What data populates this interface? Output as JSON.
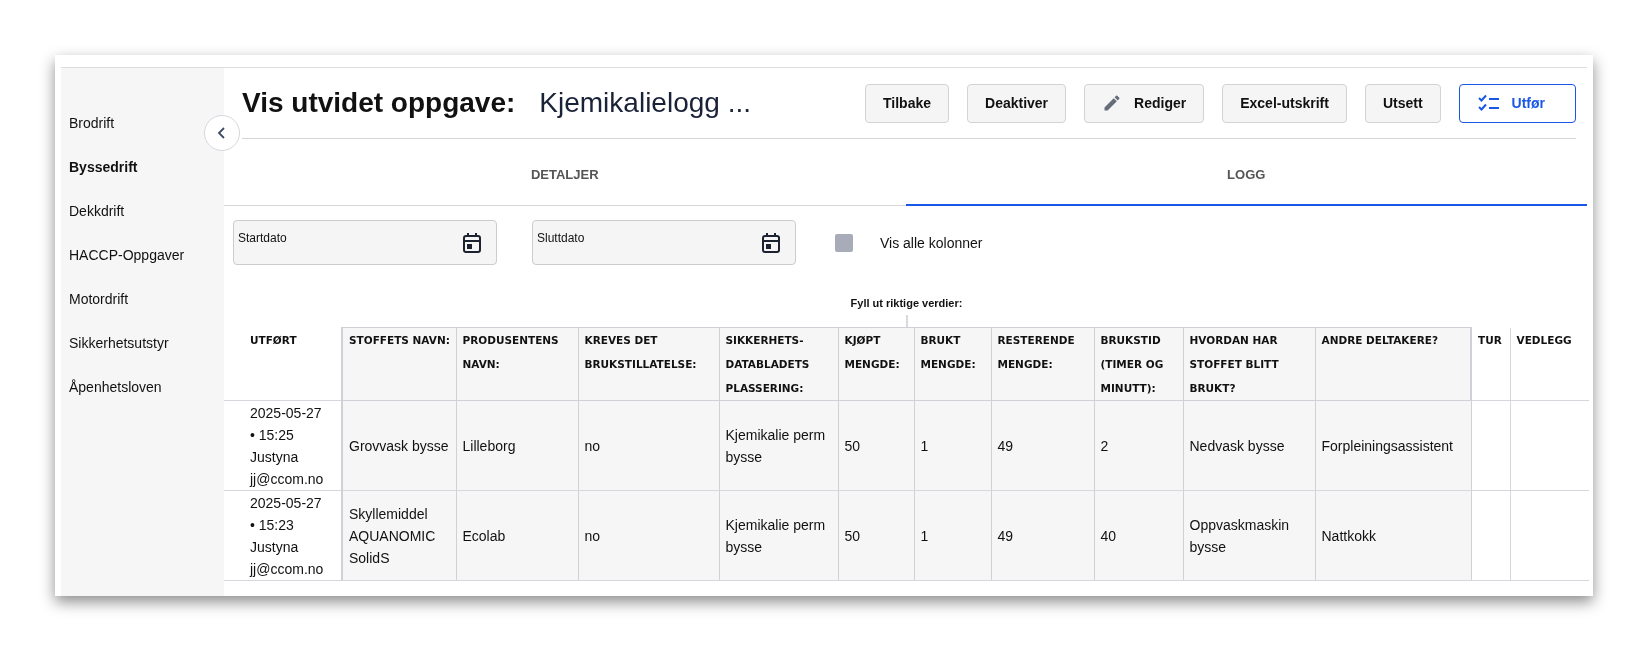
{
  "sidebar": {
    "items": [
      {
        "label": "Brodrift",
        "selected": false
      },
      {
        "label": "Byssedrift",
        "selected": true
      },
      {
        "label": "Dekkdrift",
        "selected": false
      },
      {
        "label": "HACCP-Oppgaver",
        "selected": false
      },
      {
        "label": "Motordrift",
        "selected": false
      },
      {
        "label": "Sikkerhetsutstyr",
        "selected": false
      },
      {
        "label": "Åpenhetsloven",
        "selected": false
      }
    ]
  },
  "header": {
    "title": "Vis utvidet oppgave:",
    "subtitle": "Kjemikalielogg ...",
    "buttons": [
      {
        "label": "Tilbake",
        "kind": "plain"
      },
      {
        "label": "Deaktiver",
        "kind": "plain"
      },
      {
        "label": "Rediger",
        "kind": "edit"
      },
      {
        "label": "Excel-utskrift",
        "kind": "plain"
      },
      {
        "label": "Utsett",
        "kind": "plain"
      },
      {
        "label": "Utfør",
        "kind": "primary"
      }
    ]
  },
  "tabs": [
    {
      "label": "DETALJER",
      "selected": false
    },
    {
      "label": "LOGG",
      "selected": true
    }
  ],
  "filters": {
    "fields": [
      {
        "label": "Startdato"
      },
      {
        "label": "Sluttdato"
      }
    ],
    "checkbox": {
      "label": "Vis alle kolonner",
      "checked": false
    }
  },
  "table": {
    "group_label": "Fyll ut riktige verdier:",
    "columns": [
      {
        "label": "UTFØRT",
        "grouped": false
      },
      {
        "label": "STOFFETS NAVN:",
        "grouped": true
      },
      {
        "label": "PRODUSENTENS NAVN:",
        "grouped": true
      },
      {
        "label": "KREVES DET BRUKSTILLATELSE:",
        "grouped": true
      },
      {
        "label": "SIKKERHETS-DATABLADETS PLASSERING:",
        "grouped": true
      },
      {
        "label": "KJØPT MENGDE:",
        "grouped": true
      },
      {
        "label": "BRUKT MENGDE:",
        "grouped": true
      },
      {
        "label": "RESTERENDE MENGDE:",
        "grouped": true
      },
      {
        "label": "BRUKSTID (TIMER OG MINUTT):",
        "grouped": true
      },
      {
        "label": "HVORDAN HAR STOFFET BLITT BRUKT?",
        "grouped": true
      },
      {
        "label": "ANDRE DELTAKERE?",
        "grouped": true
      },
      {
        "label": "TUR",
        "grouped": false
      },
      {
        "label": "VEDLEGG",
        "grouped": false
      }
    ],
    "rows": [
      {
        "cells": [
          "2025-05-27\n• 15:25\nJustyna\njj@ccom.no",
          "Grovvask bysse",
          "Lilleborg",
          "no",
          "Kjemikalie perm bysse",
          "50",
          "1",
          "49",
          "2",
          "Nedvask bysse",
          "Forpleiningsassistent"
        ]
      },
      {
        "cells": [
          "2025-05-27\n• 15:23\nJustyna\njj@ccom.no",
          "Skyllemiddel AQUANOMIC SolidS",
          "Ecolab",
          "no",
          "Kjemikalie perm bysse",
          "50",
          "1",
          "49",
          "40",
          "Oppvaskmaskin bysse",
          "Nattkokk"
        ]
      }
    ]
  }
}
